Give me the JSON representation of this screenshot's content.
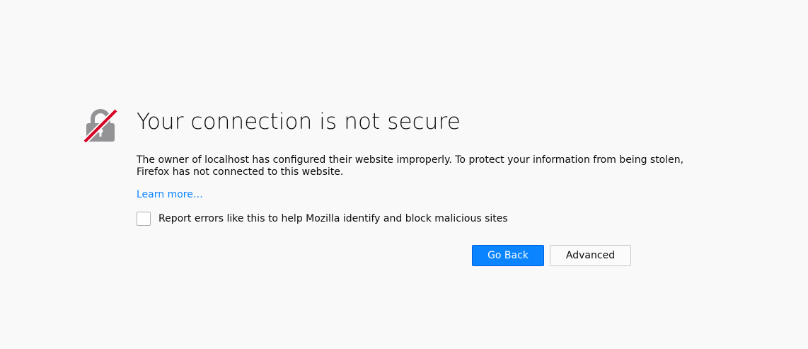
{
  "page": {
    "title": "Your connection is not secure",
    "description_line1": "The owner of localhost has configured their website improperly. To protect your information from being stolen,",
    "description_line2": "Firefox has not connected to this website.",
    "learn_more": "Learn more…",
    "report_label": "Report errors like this to help Mozilla identify and block malicious sites",
    "report_checked": false
  },
  "buttons": {
    "go_back": "Go Back",
    "advanced": "Advanced"
  },
  "icons": {
    "warning": "broken-lock-icon"
  },
  "colors": {
    "accent": "#0a84ff",
    "lock": "#939395",
    "strike": "#d70022",
    "background": "#f9f9fa"
  }
}
